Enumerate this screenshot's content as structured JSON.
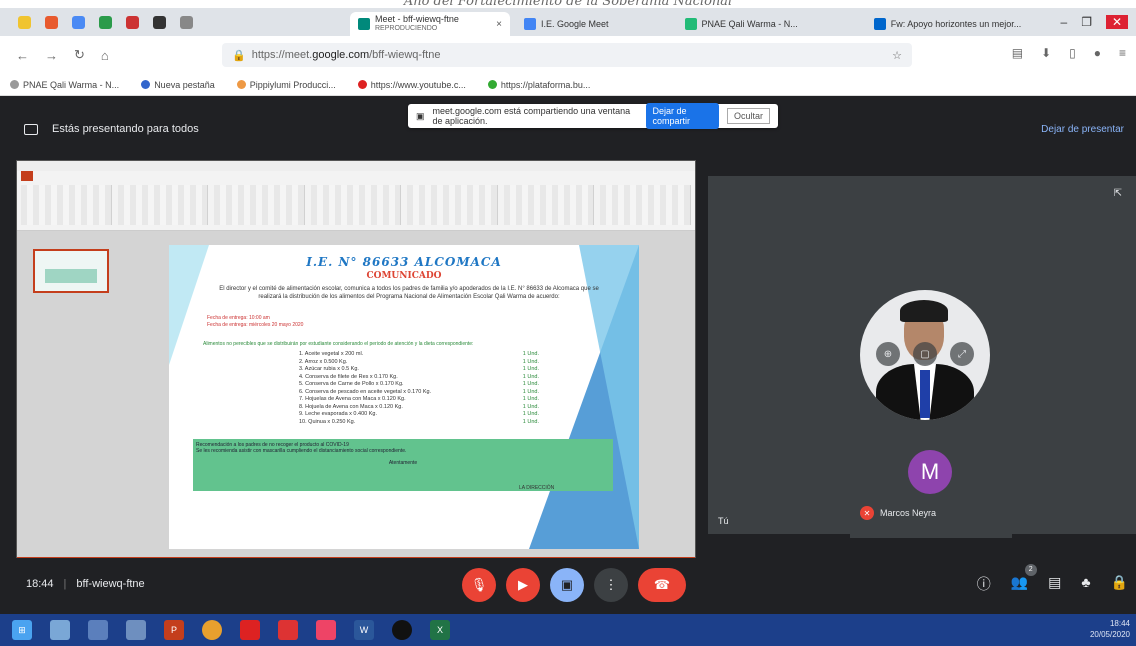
{
  "doc_header": "Año del Fortalecimiento de la Soberanía Nacional",
  "browser": {
    "active_tab": {
      "title": "Meet - bff-wiewq-ftne",
      "subtitle": "REPRODUCIENDO"
    },
    "tabs": [
      "I.E. Google Meet",
      "PNAE Qali Warma - N...",
      "Fw: Apoyo horizontes un mejor..."
    ],
    "url_prefix": "https://meet.",
    "url_domain": "google.com",
    "url_path": "/bff-wiewq-ftne",
    "bookmarks": [
      "PNAE Qali Warma - N...",
      "Nueva pestaña",
      "Pippiylumi Producci...",
      "https://www.youtube.c...",
      "https://plataforma.bu..."
    ]
  },
  "meet": {
    "share_banner": "meet.google.com está compartiendo una ventana de aplicación.",
    "stop_share": "Dejar de compartir",
    "hide": "Ocultar",
    "presenting_text": "Estás presentando para todos",
    "stop_presenting": "Dejar de presentar",
    "you_label": "Tú",
    "participant_name": "Marcos Neyra",
    "participant_initial": "M",
    "meeting_time": "18:44",
    "meeting_code": "bff-wiewq-ftne",
    "participants_count": "2"
  },
  "slide": {
    "title": "I.E. N° 86633 ALCOMACA",
    "subtitle": "COMUNICADO",
    "paragraph": "El director y el comité de alimentación escolar, comunica a todos los padres de familia y/o apoderados de la I.E. N° 86633 de Alcomaca que se realizará la distribución de los alimentos del Programa Nacional de Alimentación Escolar Qali Warma de acuerdo:",
    "date_line1": "Fecha de entrega: 10:00 am",
    "date_line2": "Fecha de entrega: miércoles 20 mayo 2020",
    "green_line": "Alimentos no perecibles que se distribuirán por estudiante considerando el periodo de atención y la dieta correspondiente:",
    "items": [
      {
        "name": "1. Aceite vegetal x 200 ml.",
        "qty": "1 Und."
      },
      {
        "name": "2. Arroz x 0.500 Kg.",
        "qty": "1 Und."
      },
      {
        "name": "3. Azúcar rubia x 0.5 Kg.",
        "qty": "1 Und."
      },
      {
        "name": "4. Conserva de filete de Res x 0.170 Kg.",
        "qty": "1 Und."
      },
      {
        "name": "5. Conserva de Carne de Pollo x 0.170 Kg.",
        "qty": "1 Und."
      },
      {
        "name": "6. Conserva de pescado en aceite vegetal x 0.170 Kg.",
        "qty": "1 Und."
      },
      {
        "name": "7. Hojuelas de Avena con Maca x 0.120 Kg.",
        "qty": "1 Und."
      },
      {
        "name": "8. Hojuela de Avena con Maca x 0.120 Kg.",
        "qty": "1 Und."
      },
      {
        "name": "9. Leche evaporada x 0.400 Kg.",
        "qty": "1 Und."
      },
      {
        "name": "10. Quinua x 0.250 Kg.",
        "qty": "1 Und."
      }
    ],
    "box_line1": "Recomendación a los padres de no recoger el producto al COVID-19",
    "box_line2": "Se les recomienda asistir con mascarilla cumpliendo el distanciamiento social correspondiente.",
    "box_center": "Atentamente",
    "box_date": "LA DIRECCIÓN"
  },
  "taskbar": {
    "time": "18:44",
    "date": "20/05/2020"
  }
}
